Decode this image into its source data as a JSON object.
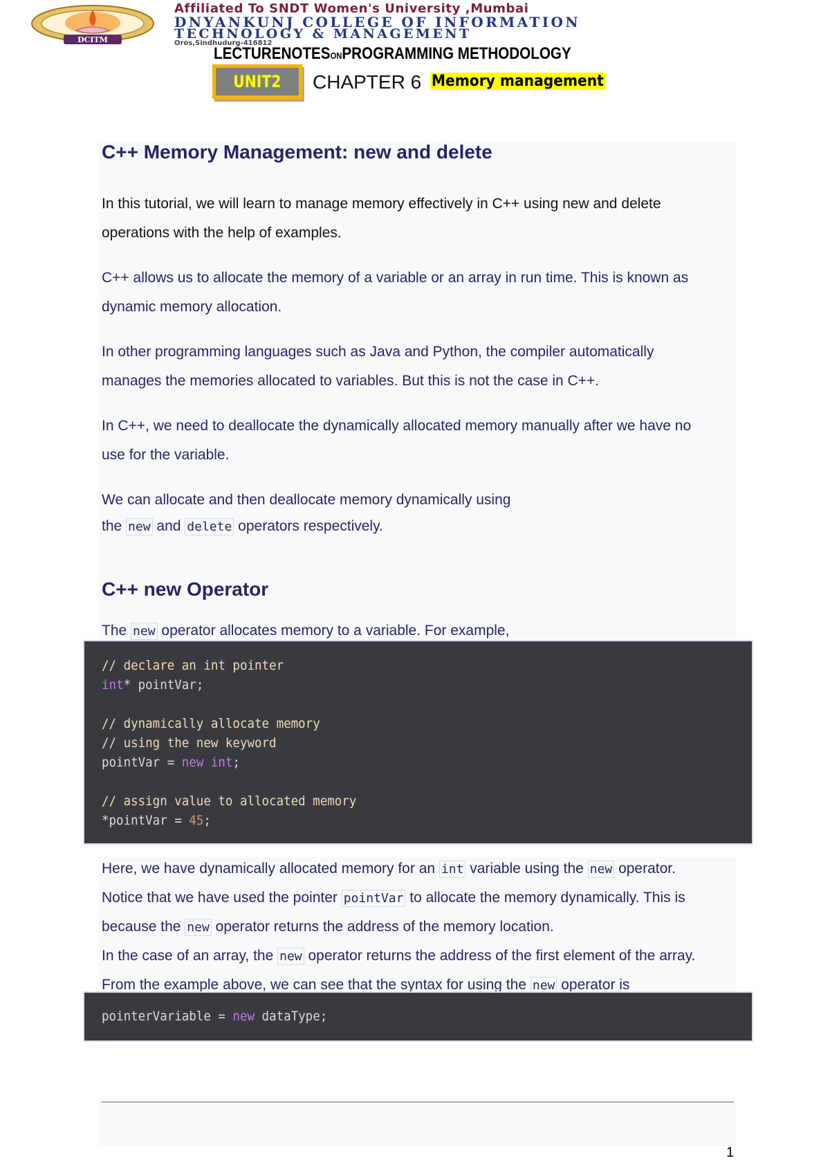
{
  "letterhead": {
    "logo_label": "DCITM",
    "affiliation": "Affiliated To SNDT Women's University ,Mumbai",
    "college_line1": "DNYANKUNJ COLLEGE OF INFORMATION",
    "college_line2": "TECHNOLOGY & MANAGEMENT",
    "address": "Oros,Sindhudurg-416812",
    "lecture_prefix": "LECTURENOTES",
    "lecture_on": "ON",
    "lecture_subject": "PROGRAMMING METHODOLOGY",
    "unit": "UNIT2",
    "chapter": "CHAPTER 6",
    "chapter_topic": "Memory management"
  },
  "section1": {
    "title": "C++ Memory Management: new and delete",
    "intro_line1": "In this tutorial, we will learn to manage memory effectively in C++ using new and delete",
    "intro_line2": "operations with the help of examples.",
    "p2_line1": "C++ allows us to allocate the memory of a variable or an array in run time. This is known as",
    "p2_line2": "dynamic memory allocation.",
    "p3_line1": "In other programming languages such as Java and Python, the compiler automatically",
    "p3_line2": "manages the memories allocated to variables. But this is not the case in C++.",
    "p4_line1": "In C++, we need to deallocate the dynamically allocated memory manually after we have no",
    "p4_line2": "use for the variable.",
    "p5_line1": "We can allocate and then deallocate memory dynamically using",
    "p5_line2_a": "the",
    "p5_code_new": "new",
    "p5_line2_b": "and",
    "p5_code_delete": "delete",
    "p5_line2_c": "operators respectively."
  },
  "section2": {
    "title": "C++ new Operator",
    "lead_a": "The",
    "lead_code": "new",
    "lead_b": "operator allocates memory to a variable. For example,",
    "code1": {
      "comment1": "// declare an int pointer",
      "l2_kw": "int",
      "l2_rest": "* pointVar;",
      "comment2": "// dynamically allocate memory",
      "comment3": "// using the new keyword",
      "l5_a": "pointVar = ",
      "l5_kw1": "new",
      "l5_kw2": "int",
      "l5_end": ";",
      "comment4": "// assign value to allocated memory",
      "l7_a": "*pointVar = ",
      "l7_num": "45",
      "l7_end": ";"
    },
    "e1_a": "Here, we have dynamically allocated memory for an",
    "e1_code1": "int",
    "e1_b": "variable using the",
    "e1_code2": "new",
    "e1_c": "operator.",
    "e2_a": "Notice that we have used the pointer",
    "e2_code": "pointVar",
    "e2_b": "to allocate the memory dynamically. This is",
    "e3_a": "because the",
    "e3_code": "new",
    "e3_b": "operator returns the address of the memory location.",
    "e4_a": "In the case of an array, the",
    "e4_code": "new",
    "e4_b": "operator returns the address of the first element of the array.",
    "e5_a": "From the example above, we can see that the syntax for using the",
    "e5_code": "new",
    "e5_b": "operator is",
    "code2": {
      "a": "pointerVariable = ",
      "kw": "new",
      "b": " dataType;"
    }
  },
  "footer": {
    "page_number": "1"
  }
}
